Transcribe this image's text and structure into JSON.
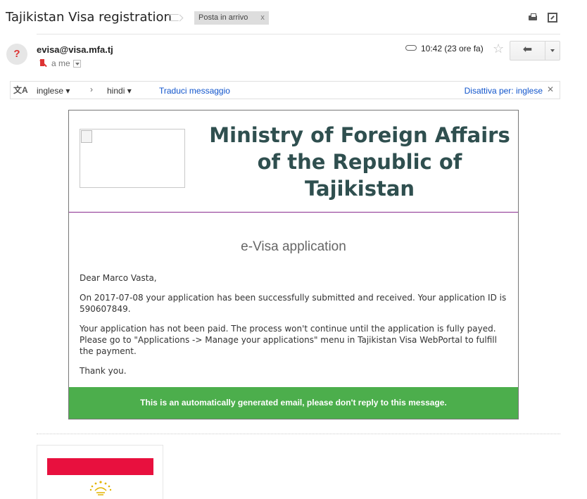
{
  "subject": {
    "title": "Tajikistan Visa registration",
    "label_chip": "Posta in arrivo",
    "label_chip_close": "x"
  },
  "header": {
    "avatar_glyph": "?",
    "sender": "evisa@visa.mfa.tj",
    "recipient": "a me",
    "time": "10:42 (23 ore fa)",
    "star": "☆",
    "reply_glyph": "⬅"
  },
  "translate": {
    "icon": "文A",
    "source_lang": "inglese ▾",
    "arrow": "›",
    "target_lang": "hindi ▾",
    "translate_link": "Traduci messaggio",
    "disable_link": "Disattiva per: inglese",
    "close": "✕"
  },
  "email": {
    "ministry_title": "Ministry of Foreign Affairs of the Republic of Tajikistan",
    "evisa_title": "e-Visa application",
    "greeting": "Dear Marco Vasta,",
    "para1": "On 2017-07-08 your application has been successfully submitted and received. Your application ID is 590607849.",
    "para2a": "Your application has not been paid. The process won't continue until the application is fully payed.",
    "para2b": "Please go to \"Applications -> Manage your applications\" menu in Tajikistan Visa WebPortal to fulfill the payment.",
    "closing": "Thank you.",
    "footer": "This is an automatically generated email, please don't reply to this message."
  },
  "colors": {
    "ministry_title": "#2f4f4f",
    "footer_bg": "#4cae4c",
    "header_divider": "#8b2c8f",
    "link": "#15c",
    "flag_red": "#e8103e"
  },
  "icons": [
    "label-icon",
    "print-icon",
    "popout-icon",
    "unknown-sender-icon",
    "no-entry-icon",
    "attachment-icon",
    "star-icon",
    "reply-icon",
    "more-options-icon",
    "translate-icon",
    "broken-image-icon",
    "flag-image"
  ]
}
